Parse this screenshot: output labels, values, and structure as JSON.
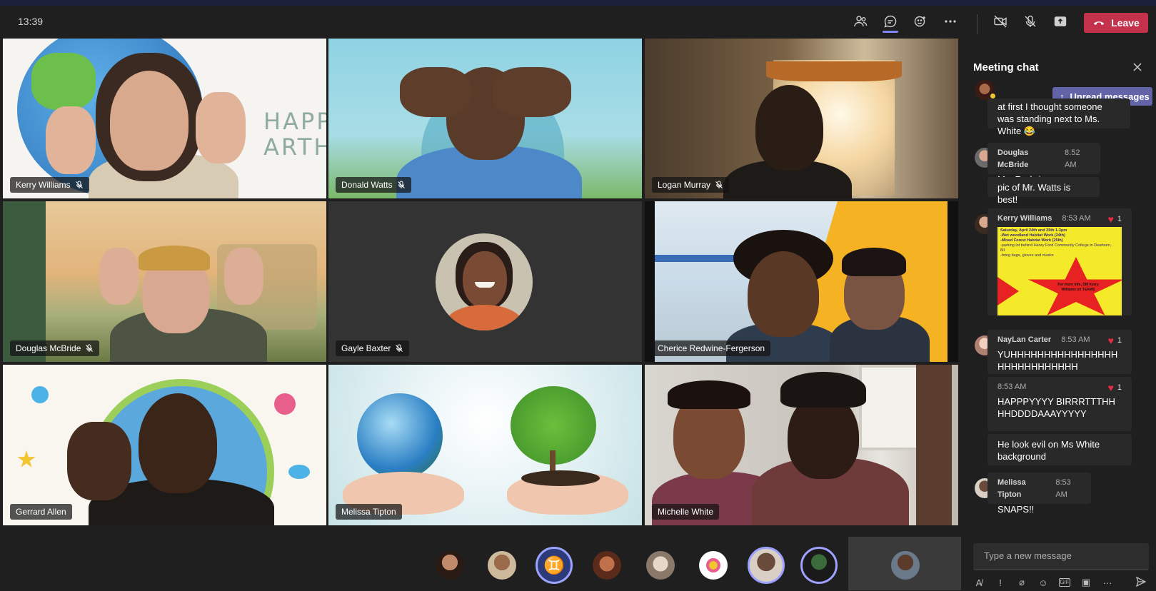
{
  "topbar": {
    "time": "13:39",
    "icons": [
      "participants-icon",
      "chat-icon",
      "reactions-icon",
      "more-icon",
      "camera-off-icon",
      "mic-off-icon",
      "share-icon"
    ],
    "leave_label": "Leave"
  },
  "tiles": [
    {
      "name": "Kerry Williams",
      "muted": true,
      "bg_text": "HAPP\nARTH M"
    },
    {
      "name": "Donald Watts",
      "muted": true
    },
    {
      "name": "Logan Murray",
      "muted": true
    },
    {
      "name": "Douglas McBride",
      "muted": true
    },
    {
      "name": "Gayle Baxter",
      "muted": true
    },
    {
      "name": "Cherice Redwine-Fergerson",
      "muted": false
    },
    {
      "name": "Gerrard Allen",
      "muted": false
    },
    {
      "name": "Melissa Tipton",
      "muted": false
    },
    {
      "name": "Michelle White",
      "muted": false
    }
  ],
  "chat": {
    "title": "Meeting chat",
    "unread_label": "Unread messages",
    "messages": [
      {
        "author": "",
        "time": "",
        "text": "at first I thought someone was standing next to Ms. White 😂"
      },
      {
        "author": "Douglas McBride",
        "time": "8:52 AM",
        "text": "Ms. Redwines"
      },
      {
        "author": "",
        "time": "",
        "text": "pic of Mr. Watts is best!"
      },
      {
        "author": "Kerry Williams",
        "time": "8:53 AM",
        "reaction_count": "1",
        "text": ""
      },
      {
        "author": "NayLan Carter",
        "time": "8:53 AM",
        "reaction_count": "1",
        "text": "YUHHHHHHHHHHHHHHHHHHHHHHHHHHHH"
      },
      {
        "author": "",
        "time": "8:53 AM",
        "reaction_count": "1",
        "text": "HAPPPYYYY BIRRRTTTHHHHDDDDAAAYYYYY"
      },
      {
        "author": "",
        "time": "",
        "text": "He look evil on Ms White background"
      },
      {
        "author": "Melissa Tipton",
        "time": "8:53 AM",
        "text": "SNAPS!!"
      }
    ],
    "flyer": {
      "line1": "Saturday, April 24th and 25th 1-3pm",
      "line2": "-Wet woodland Habitat Work (24th)",
      "line3": "-Mixed Forest Habitat Work (25th)",
      "line4": "-parking lot behind Henry Ford Community College in Dearborn, MI",
      "line5": "-bring bags, gloves and masks",
      "star_text": "For more info, DM Kerry Williams on TEAMS"
    },
    "compose_placeholder": "Type a new message"
  },
  "colors": {
    "leave": "#c4314b",
    "accent": "#6264a7",
    "heart": "#e82d43"
  }
}
